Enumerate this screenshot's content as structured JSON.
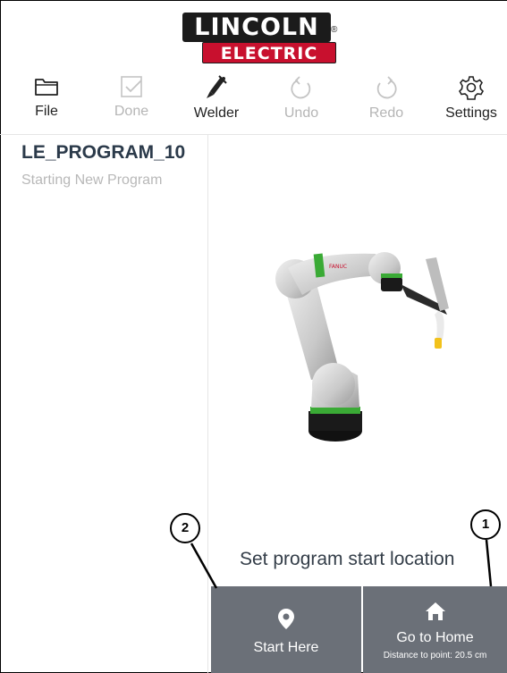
{
  "logo": {
    "top_text": "LINCOLN",
    "bottom_text": "ELECTRIC",
    "reg_mark": "®"
  },
  "toolbar": {
    "items": [
      {
        "label": "File",
        "icon": "folder-icon",
        "enabled": true
      },
      {
        "label": "Done",
        "icon": "checkbox-icon",
        "enabled": false
      },
      {
        "label": "Welder",
        "icon": "welding-torch-icon",
        "enabled": true
      },
      {
        "label": "Undo",
        "icon": "undo-icon",
        "enabled": false
      },
      {
        "label": "Redo",
        "icon": "redo-icon",
        "enabled": false
      },
      {
        "label": "Settings",
        "icon": "gear-icon",
        "enabled": true
      }
    ]
  },
  "program": {
    "name": "LE_PROGRAM_10",
    "status": "Starting New Program"
  },
  "prompt": "Set program start location",
  "buttons": {
    "start_here": {
      "label": "Start Here",
      "icon": "location-pin-icon"
    },
    "go_home": {
      "label": "Go to Home",
      "sub": "Distance to point: 20.5 cm",
      "icon": "home-icon"
    }
  },
  "callouts": [
    "1",
    "2"
  ],
  "colors": {
    "button_bg": "#6b7078",
    "brand_red": "#c8102e",
    "robot_accent": "#3aaa35"
  }
}
